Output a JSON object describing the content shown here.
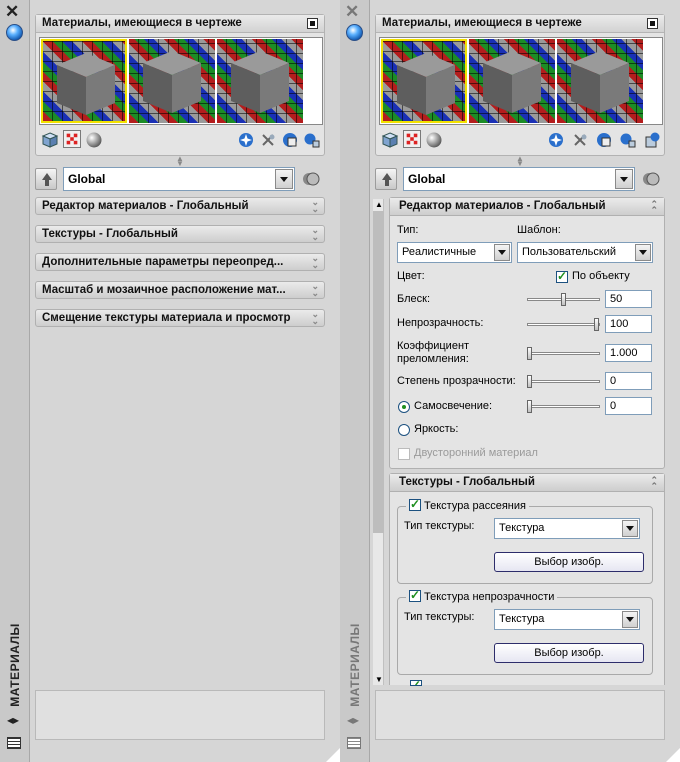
{
  "left": {
    "strip_title": "МАТЕРИАЛЫ",
    "panel_title": "Материалы, имеющиеся в чертеже",
    "material_select": "Global",
    "collapsed_sections": [
      "Редактор материалов - Глобальный",
      "Текстуры - Глобальный",
      "Дополнительные параметры переопред...",
      "Масштаб и мозаичное расположение мат...",
      "Смещение текстуры материала и просмотр"
    ]
  },
  "right": {
    "strip_title": "МАТЕРИАЛЫ",
    "panel_title": "Материалы, имеющиеся в чертеже",
    "material_select": "Global",
    "editor": {
      "title": "Редактор материалов - Глобальный",
      "type_label": "Тип:",
      "type_value": "Реалистичные",
      "template_label": "Шаблон:",
      "template_value": "Пользовательский",
      "color_label": "Цвет:",
      "by_object_label": "По объекту",
      "by_object_checked": true,
      "shininess_label": "Блеск:",
      "shininess_value": "50",
      "shininess_level": 0.5,
      "opacity_label": "Непрозрачность:",
      "opacity_value": "100",
      "opacity_level": 1.0,
      "refraction_label": "Коэффициент преломления:",
      "refraction_value": "1.000",
      "refraction_level": 0.0,
      "translucency_label": "Степень прозрачности:",
      "translucency_value": "0",
      "translucency_level": 0.0,
      "self_illum_label": "Самосвечение:",
      "self_illum_value": "0",
      "self_illum_level": 0.0,
      "luminance_label": "Яркость:",
      "two_sided_label": "Двусторонний материал"
    },
    "textures": {
      "title": "Текстуры - Глобальный",
      "diffuse_label": "Текстура рассеяния",
      "diffuse_checked": true,
      "diffuse_type_label": "Тип текстуры:",
      "diffuse_type_value": "Текстура",
      "diffuse_button": "Выбор изобр.",
      "opacity_label": "Текстура непрозрачности",
      "opacity_checked": true,
      "opacity_type_label": "Тип текстуры:",
      "opacity_type_value": "Текстура",
      "opacity_button": "Выбор изобр."
    }
  },
  "colors": {
    "panel_bg": "#d6d6d6",
    "selected_swatch_border": "#f2e200",
    "check_mark": "#1f8f1f"
  }
}
